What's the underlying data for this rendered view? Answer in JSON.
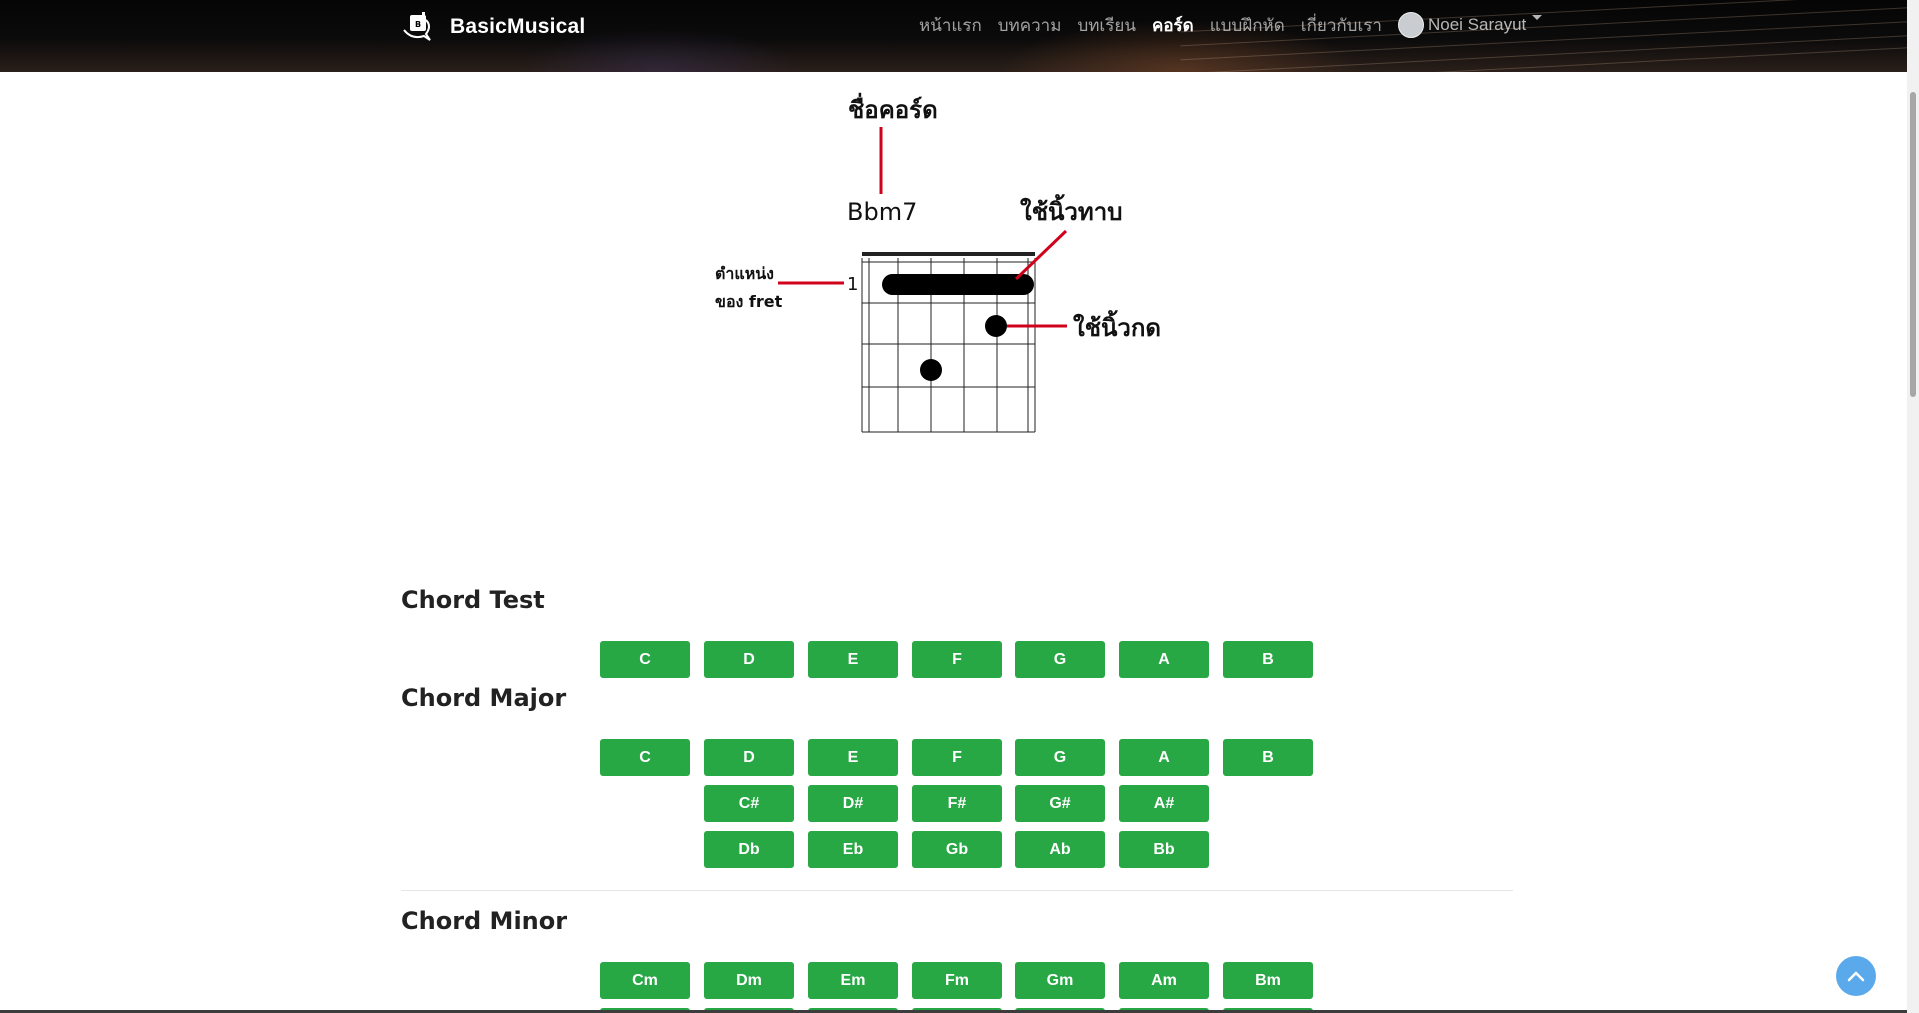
{
  "navbar": {
    "brand": "BasicMusical",
    "items": [
      {
        "label": "หน้าแรก",
        "active": false
      },
      {
        "label": "บทความ",
        "active": false
      },
      {
        "label": "บทเรียน",
        "active": false
      },
      {
        "label": "คอร์ด",
        "active": true
      },
      {
        "label": "แบบฝึกหัด",
        "active": false
      },
      {
        "label": "เกี่ยวกับเรา",
        "active": false
      }
    ],
    "user": "Noei Sarayut"
  },
  "diagram": {
    "chord_name_label": "ชื่อคอร์ด",
    "chord": "Bbm7",
    "barre_label": "ใช้นิ้วทาบ",
    "press_label": "ใช้นิ้วกด",
    "fret_position_line1": "ตำแหน่ง",
    "fret_position_line2": "ของ fret",
    "start_fret": "1"
  },
  "sections": [
    {
      "title": "Chord Test",
      "rows": [
        [
          "C",
          "D",
          "E",
          "F",
          "G",
          "A",
          "B"
        ]
      ]
    },
    {
      "title": "Chord Major",
      "rows": [
        [
          "C",
          "D",
          "E",
          "F",
          "G",
          "A",
          "B"
        ],
        [
          "C#",
          "D#",
          "F#",
          "G#",
          "A#"
        ],
        [
          "Db",
          "Eb",
          "Gb",
          "Ab",
          "Bb"
        ]
      ]
    },
    {
      "title": "Chord Minor",
      "rows": [
        [
          "Cm",
          "Dm",
          "Em",
          "Fm",
          "Gm",
          "Am",
          "Bm"
        ]
      ]
    }
  ],
  "colors": {
    "button": "#28a745",
    "annotation": "#d0021b",
    "scroll_top": "#5aa9ea"
  },
  "icons": {
    "logo": "guitar-logo-icon",
    "scroll_top": "chevron-up-icon"
  }
}
